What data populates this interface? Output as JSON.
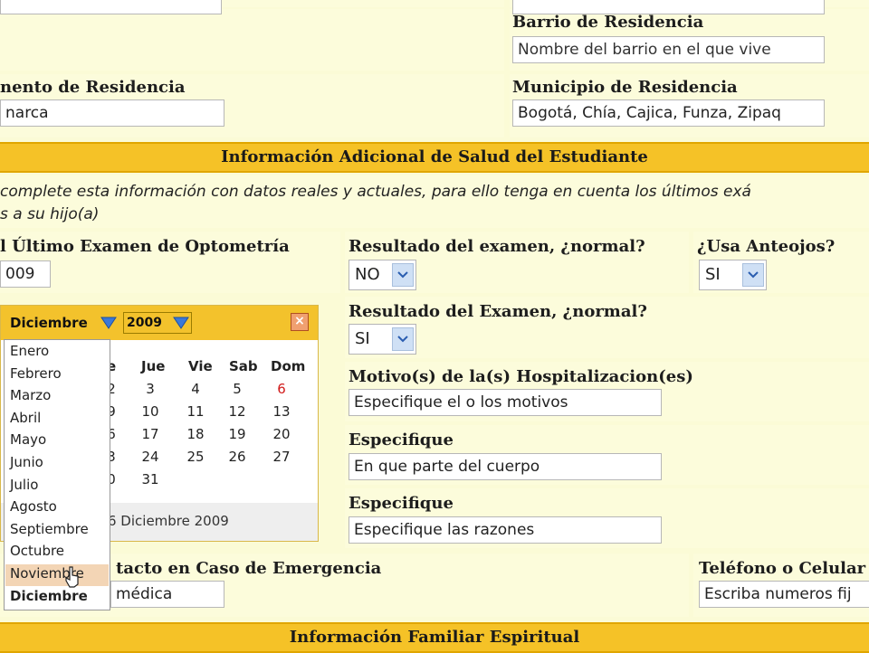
{
  "top": {
    "barrio_label": "Barrio de Residencia",
    "barrio_placeholder": "Nombre del barrio en el que vive",
    "depto_label": "nento de Residencia",
    "depto_value": "narca",
    "municipio_label": "Municipio de Residencia",
    "municipio_value": "Bogotá, Chía, Cajica, Funza, Zipaq"
  },
  "salud": {
    "header": "Información Adicional de Salud del Estudiante",
    "note_line1": "complete esta información con datos reales y actuales, para ello tenga en cuenta los últimos exá",
    "note_line2": "s a su hijo(a)",
    "optometria_label": "l Último Examen de Optometría",
    "optometria_value": "009",
    "resultado_label": "Resultado del examen, ¿normal?",
    "resultado_value": "NO",
    "anteojos_label": "¿Usa Anteojos?",
    "anteojos_value": "SI",
    "resultado2_label": "Resultado del Examen, ¿normal?",
    "resultado2_value": "SI",
    "motivos_label": "Motivo(s) de la(s) Hospitalizacion(es)",
    "motivos_placeholder": "Especifique el o los motivos",
    "especifique1_label": "Especifique",
    "especifique1_placeholder": "En que parte del cuerpo",
    "especifique2_label": "Especifique",
    "especifique2_placeholder": "Especifique las razones",
    "contacto_label": "tacto en Caso de Emergencia",
    "contacto_value": "médica",
    "telefono_label": "Teléfono o Celular",
    "telefono_placeholder": "Escriba numeros fij"
  },
  "familiar": {
    "header": "Información Familiar Espiritual"
  },
  "calendar": {
    "month": "Diciembre",
    "year": "2009",
    "close": "×",
    "days_of_week": [
      "e",
      "Jue",
      "Vie",
      "Sab",
      "Dom"
    ],
    "rows": [
      [
        "2",
        "3",
        "4",
        "5",
        "6"
      ],
      [
        "9",
        "10",
        "11",
        "12",
        "13"
      ],
      [
        "6",
        "17",
        "18",
        "19",
        "20"
      ],
      [
        "3",
        "24",
        "25",
        "26",
        "27"
      ],
      [
        "0",
        "31",
        "",
        "",
        ""
      ]
    ],
    "footer": "6 Diciembre 2009",
    "month_options": [
      "Enero",
      "Febrero",
      "Marzo",
      "Abril",
      "Mayo",
      "Junio",
      "Julio",
      "Agosto",
      "Septiembre",
      "Octubre",
      "Noviembre",
      "Diciembre"
    ],
    "highlighted_option": "Noviembre",
    "sunday_color": "#d11a1a"
  },
  "colors": {
    "section_bar": "#f5c227",
    "background": "#fbfbd6"
  }
}
